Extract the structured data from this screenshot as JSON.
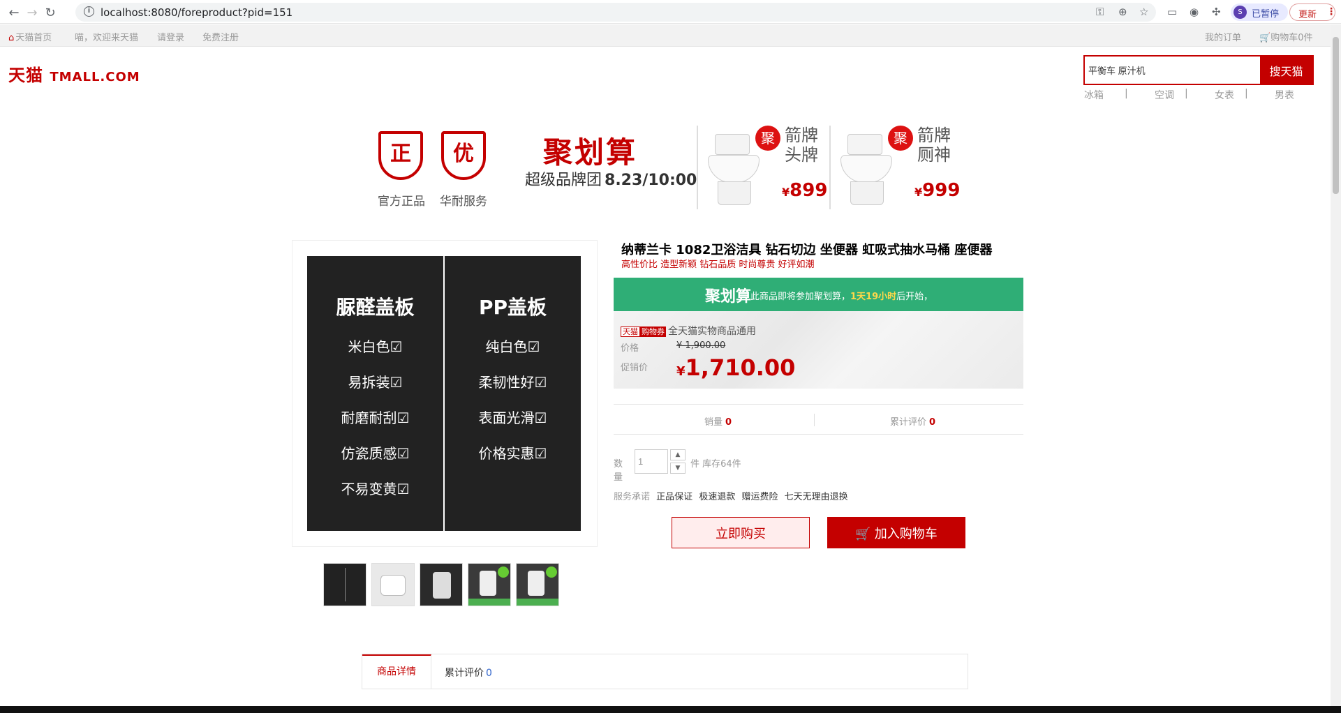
{
  "browser": {
    "url": "localhost:8080/foreproduct?pid=151",
    "profile_initial": "S",
    "profile_label": "已暂停",
    "update_label": "更新"
  },
  "topbar": {
    "home": "天猫首页",
    "welcome": "喵，欢迎来天猫",
    "login": "请登录",
    "register": "免费注册",
    "my_orders": "我的订单",
    "cart": "购物车0件"
  },
  "header": {
    "logo_cn": "天猫",
    "logo_en": "TMALL.COM",
    "search_value": "平衡车 原汁机",
    "search_button": "搜天猫",
    "hot_words": [
      "冰箱",
      "|",
      "空调",
      "|",
      "女表",
      "|",
      "男表"
    ]
  },
  "banner": {
    "badge1": "正",
    "badge1_caption": "官方正品",
    "badge2": "优",
    "badge2_caption": "华耐服务",
    "juhua_title": "聚划算",
    "juhua_sub": "超级品牌团",
    "juhua_date": "8.23/10:00",
    "promo1_ball": "聚",
    "promo1_name": "箭牌头牌",
    "promo1_price": "899",
    "promo2_ball": "聚",
    "promo2_name": "箭牌厕神",
    "promo2_price": "999",
    "currency": "¥"
  },
  "gallery": {
    "left_title": "脲醛盖板",
    "left_items": [
      "米白色☑",
      "易拆装☑",
      "耐磨耐刮☑",
      "仿瓷质感☑",
      "不易变黄☑"
    ],
    "right_title": "PP盖板",
    "right_items": [
      "纯白色☑",
      "柔韧性好☑",
      "表面光滑☑",
      "价格实惠☑"
    ]
  },
  "product": {
    "title": "纳蒂兰卡 1082卫浴洁具 钻石切边 坐便器 虹吸式抽水马桶 座便器",
    "subtitle": "高性价比 造型新颖 钻石品质 时尚尊贵 好评如潮",
    "juhua_label": "聚划算",
    "juhua_text_pre": "此商品即将参加聚划算，",
    "juhua_time": "1天19小时",
    "juhua_text_post": "后开始，",
    "tag_tmall": "天猫",
    "tag_coupon": "购物券",
    "tag_text": "全天猫实物商品通用",
    "price_label": "价格",
    "price_original": "¥ 1,900.00",
    "promo_label": "促销价",
    "promo_currency": "¥",
    "promo_value": "1,710.00",
    "sales_label": "销量",
    "sales_value": "0",
    "reviews_label": "累计评价",
    "reviews_value": "0",
    "qty_label": "数量",
    "qty_value": "1",
    "stock_text": "件 库存64件",
    "service_label": "服务承诺",
    "services": [
      "正品保证",
      "极速退款",
      "赠运费险",
      "七天无理由退换"
    ],
    "buy_now": "立即购买",
    "add_cart": "加入购物车"
  },
  "tabs": {
    "detail": "商品详情",
    "reviews": "累计评价",
    "reviews_count": "0"
  }
}
